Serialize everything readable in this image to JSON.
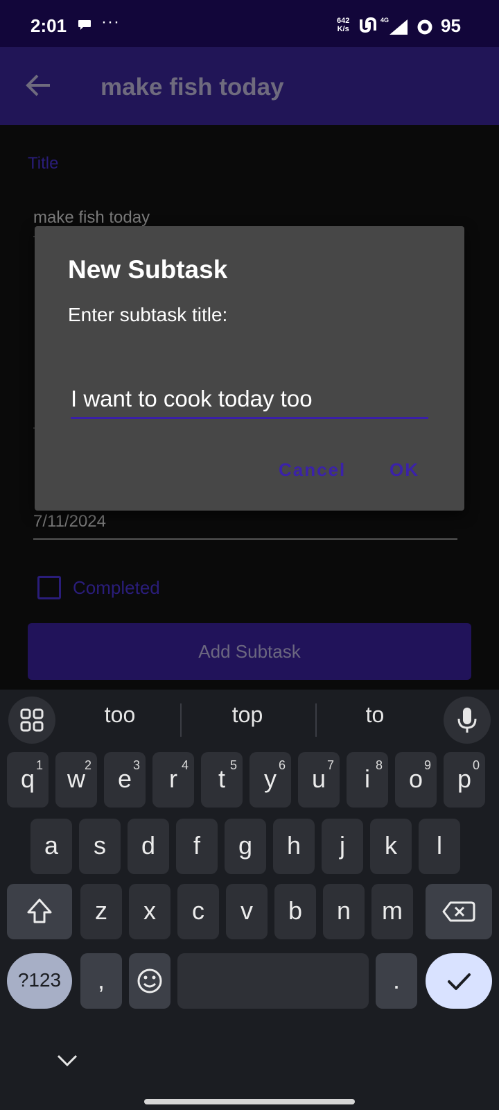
{
  "status_bar": {
    "time": "2:01",
    "dots": "···",
    "speed_top": "642",
    "speed_bottom": "K/s",
    "network_type": "4G",
    "battery": "95"
  },
  "app_bar": {
    "title": "make fish today"
  },
  "form": {
    "title_label": "Title",
    "title_value": "make fish today",
    "date_value": "7/11/2024",
    "completed_label": "Completed",
    "add_subtask_label": "Add Subtask"
  },
  "dialog": {
    "title": "New Subtask",
    "message": "Enter subtask title:",
    "input_value": "I want to cook today too",
    "cancel_label": "Cancel",
    "ok_label": "OK"
  },
  "keyboard": {
    "suggestions": [
      "too",
      "top",
      "to"
    ],
    "row1": [
      {
        "k": "q",
        "h": "1"
      },
      {
        "k": "w",
        "h": "2"
      },
      {
        "k": "e",
        "h": "3"
      },
      {
        "k": "r",
        "h": "4"
      },
      {
        "k": "t",
        "h": "5"
      },
      {
        "k": "y",
        "h": "6"
      },
      {
        "k": "u",
        "h": "7"
      },
      {
        "k": "i",
        "h": "8"
      },
      {
        "k": "o",
        "h": "9"
      },
      {
        "k": "p",
        "h": "0"
      }
    ],
    "row2": [
      "a",
      "s",
      "d",
      "f",
      "g",
      "h",
      "j",
      "k",
      "l"
    ],
    "row3": [
      "z",
      "x",
      "c",
      "v",
      "b",
      "n",
      "m"
    ],
    "symbols_label": "?123",
    "comma": ",",
    "period": "."
  },
  "colors": {
    "accent": "#3b22a8",
    "dialog_bg": "#474747",
    "appbar": "#211557",
    "statusbar": "#12063a"
  }
}
